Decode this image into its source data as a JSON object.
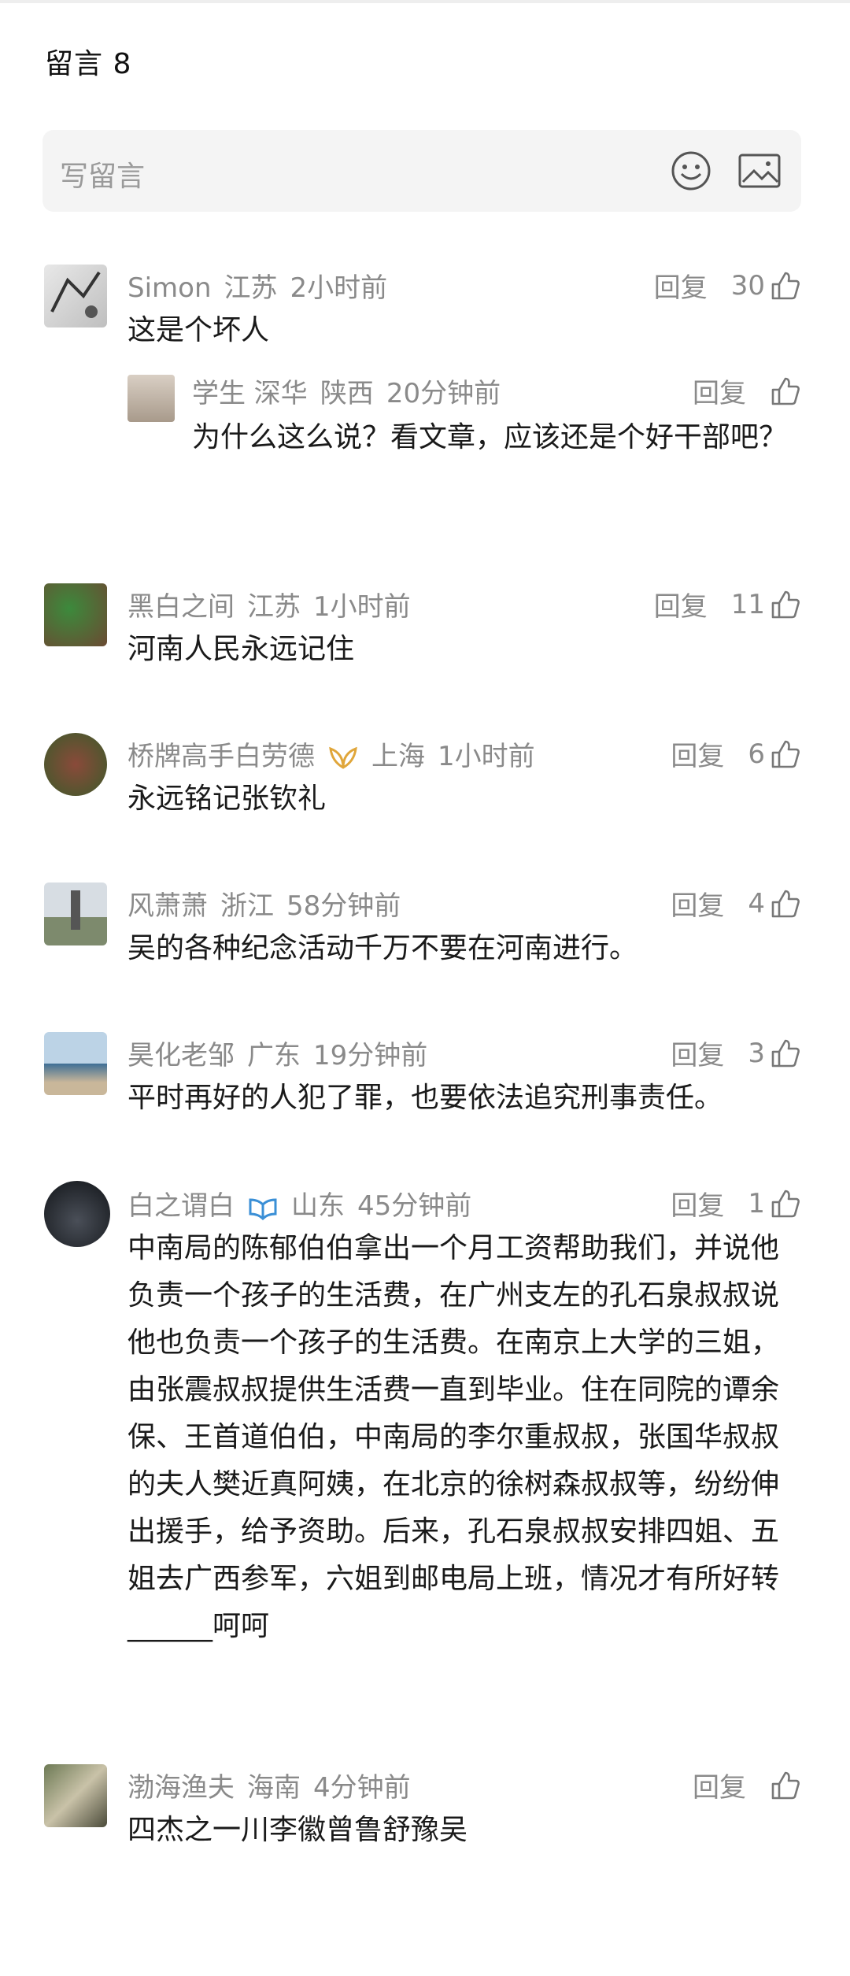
{
  "header": {
    "title": "留言 8"
  },
  "input": {
    "placeholder": "写留言"
  },
  "icons": {
    "emoji": "emoji-icon",
    "image": "image-icon",
    "like": "thumbs-up-icon"
  },
  "comments": [
    {
      "user": "Simon",
      "location": "江苏",
      "time": "2小时前",
      "reply_label": "回复",
      "likes": "30",
      "text": "这是个坏人",
      "replies": [
        {
          "user": "学生 深华",
          "location": "陕西",
          "time": "20分钟前",
          "reply_label": "回复",
          "likes": "",
          "text": "为什么这么说？看文章，应该还是个好干部吧？"
        }
      ]
    },
    {
      "user": "黑白之间",
      "location": "江苏",
      "time": "1小时前",
      "reply_label": "回复",
      "likes": "11",
      "text": "河南人民永远记住"
    },
    {
      "user": "桥牌高手白劳德",
      "location": "上海",
      "time": "1小时前",
      "reply_label": "回复",
      "likes": "6",
      "text": "永远铭记张钦礼"
    },
    {
      "user": "风萧萧",
      "location": "浙江",
      "time": "58分钟前",
      "reply_label": "回复",
      "likes": "4",
      "text": "吴的各种纪念活动千万不要在河南进行。"
    },
    {
      "user": "昊化老邹",
      "location": "广东",
      "time": "19分钟前",
      "reply_label": "回复",
      "likes": "3",
      "text": "平时再好的人犯了罪，也要依法追究刑事责任。"
    },
    {
      "user": "白之谓白",
      "location": "山东",
      "time": "45分钟前",
      "reply_label": "回复",
      "likes": "1",
      "text": "中南局的陈郁伯伯拿出一个月工资帮助我们，并说他负责一个孩子的生活费，在广州支左的孔石泉叔叔说他也负责一个孩子的生活费。在南京上大学的三姐，由张震叔叔提供生活费一直到毕业。住在同院的谭余保、王首道伯伯，中南局的李尔重叔叔，张国华叔叔的夫人樊近真阿姨，在北京的徐树森叔叔等，纷纷伸出援手，给予资助。后来，孔石泉叔叔安排四姐、五姐去广西参军，六姐到邮电局上班，情况才有所好转______呵呵"
    },
    {
      "user": "渤海渔夫",
      "location": "海南",
      "time": "4分钟前",
      "reply_label": "回复",
      "likes": "",
      "text": "四杰之一川李徽曾鲁舒豫吴"
    }
  ]
}
